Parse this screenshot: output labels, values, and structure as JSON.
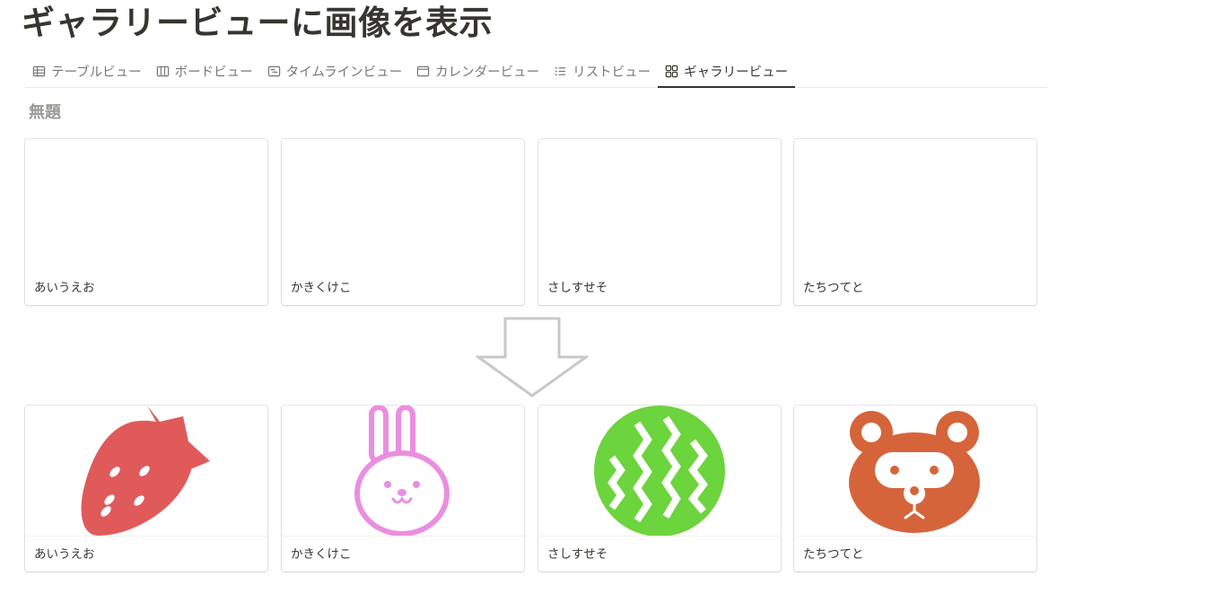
{
  "page": {
    "title": "ギャラリービューに画像を表示"
  },
  "tabs": [
    {
      "label": "テーブルビュー",
      "icon": "table-icon"
    },
    {
      "label": "ボードビュー",
      "icon": "board-icon"
    },
    {
      "label": "タイムラインビュー",
      "icon": "timeline-icon"
    },
    {
      "label": "カレンダービュー",
      "icon": "calendar-icon"
    },
    {
      "label": "リストビュー",
      "icon": "list-icon"
    },
    {
      "label": "ギャラリービュー",
      "icon": "gallery-icon",
      "active": true
    }
  ],
  "group": {
    "name": "無題"
  },
  "before_cards": [
    {
      "name": "あいうえお"
    },
    {
      "name": "かきくけこ"
    },
    {
      "name": "さしすせそ"
    },
    {
      "name": "たちつてと"
    }
  ],
  "after_cards": [
    {
      "name": "あいうえお",
      "image": "strawberry-icon",
      "color": "#e05a5a"
    },
    {
      "name": "かきくけこ",
      "image": "rabbit-icon",
      "color": "#ea8ee0"
    },
    {
      "name": "さしすせそ",
      "image": "watermelon-icon",
      "color": "#6cd43c"
    },
    {
      "name": "たちつてと",
      "image": "raccoon-dog-icon",
      "color": "#d6643a"
    }
  ]
}
